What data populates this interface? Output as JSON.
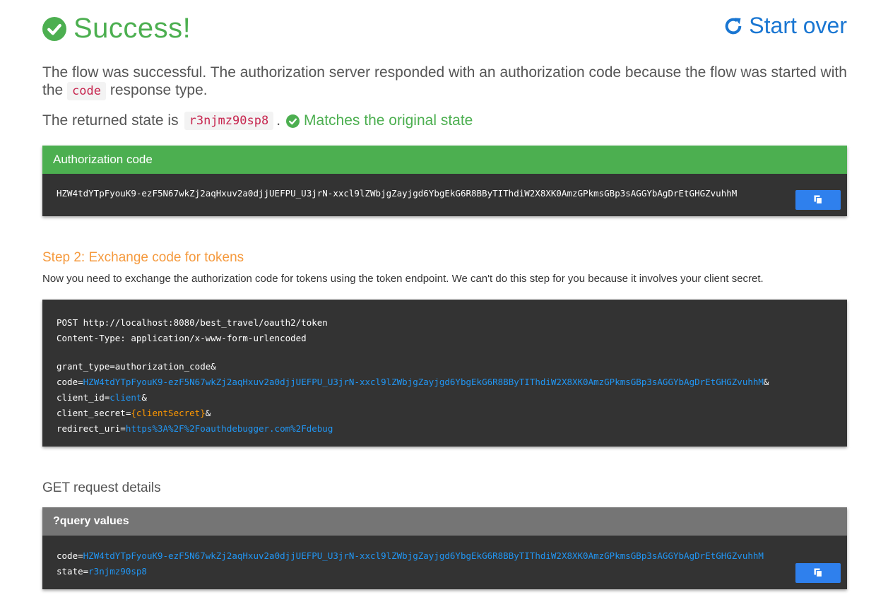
{
  "header": {
    "title": "Success!",
    "start_over": "Start over"
  },
  "lead": {
    "before": "The flow was successful. The authorization server responded with an authorization code because the flow was started with the",
    "code": "code",
    "after": "response type."
  },
  "state": {
    "prefix": "The returned state is",
    "value": "r3njmz90sp8",
    "period": ".",
    "match": "Matches the original state"
  },
  "auth_card": {
    "title": "Authorization code",
    "code": "HZW4tdYTpFyouK9-ezF5N67wkZj2aqHxuv2a0djjUEFPU_U3jrN-xxcl9lZWbjgZayjgd6YbgEkG6R8BByTIThdiW2X8XK0AmzGPkmsGBp3sAGGYbAgDrEtGHGZvuhhM"
  },
  "step2": {
    "title": "Step 2: Exchange code for tokens",
    "description": "Now you need to exchange the authorization code for tokens using the token endpoint. We can't do this step for you because it involves your client secret."
  },
  "post_request": {
    "line1": "POST http://localhost:8080/best_travel/oauth2/token",
    "line2": "Content-Type: application/x-www-form-urlencoded",
    "grant_type": "grant_type=authorization_code&",
    "code_key": "code=",
    "code_value": "HZW4tdYTpFyouK9-ezF5N67wkZj2aqHxuv2a0djjUEFPU_U3jrN-xxcl9lZWbjgZayjgd6YbgEkG6R8BByTIThdiW2X8XK0AmzGPkmsGBp3sAGGYbAgDrEtGHGZvuhhM",
    "amp": "&",
    "client_id_key": "client_id=",
    "client_id_value": "client",
    "client_secret_key": "client_secret=",
    "client_secret_value": "{clientSecret}",
    "redirect_uri_key": "redirect_uri=",
    "redirect_uri_value": "https%3A%2F%2Foauthdebugger.com%2Fdebug"
  },
  "get_details": {
    "title": "GET request details",
    "card_title": "?query values",
    "code_key": "code=",
    "code_value": "HZW4tdYTpFyouK9-ezF5N67wkZj2aqHxuv2a0djjUEFPU_U3jrN-xxcl9lZWbjgZayjgd6YbgEkG6R8BByTIThdiW2X8XK0AmzGPkmsGBp3sAGGYbAgDrEtGHGZvuhhM",
    "state_key": "state=",
    "state_value": "r3njmz90sp8"
  },
  "icons": {
    "success": "check-circle-icon",
    "start_over": "refresh-icon",
    "copy": "copy-icon"
  },
  "colors": {
    "success_green": "#4caf50",
    "link_blue": "#1976d2",
    "step_orange": "#f59a3e",
    "code_bg": "#333333",
    "copy_button": "#2f80ed",
    "query_header": "#757575"
  }
}
